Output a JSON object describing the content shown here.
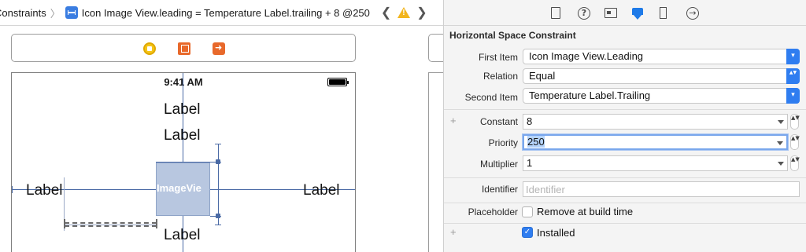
{
  "jumpbar": {
    "crumb_parent": "Constraints",
    "crumb_current": "Icon Image View.leading = Temperature Label.trailing + 8 @250",
    "prev_glyph": "❮",
    "next_glyph": "❯"
  },
  "canvas": {
    "status_time": "9:41 AM",
    "labels": {
      "top_1": "Label",
      "top_2": "Label",
      "left": "Label",
      "right": "Label",
      "bottom": "Label"
    },
    "image_view_text": "ImageVie",
    "dock_icons": [
      "view-controller-icon",
      "first-responder-icon",
      "exit-icon"
    ]
  },
  "inspector": {
    "tabs": [
      "file-icon",
      "help-icon",
      "identity-icon",
      "attributes-icon",
      "size-icon",
      "connections-icon"
    ],
    "active_tab": "attributes-icon",
    "section_title": "Horizontal Space Constraint",
    "first_item": {
      "label": "First Item",
      "value": "Icon Image View.Leading"
    },
    "relation": {
      "label": "Relation",
      "value": "Equal"
    },
    "second_item": {
      "label": "Second Item",
      "value": "Temperature Label.Trailing"
    },
    "constant": {
      "label": "Constant",
      "value": "8"
    },
    "priority": {
      "label": "Priority",
      "value": "250"
    },
    "multiplier": {
      "label": "Multiplier",
      "value": "1"
    },
    "identifier": {
      "label": "Identifier",
      "placeholder": "Identifier"
    },
    "placeholder": {
      "label": "Placeholder",
      "option": "Remove at build time",
      "checked": false
    },
    "installed": {
      "option": "Installed",
      "checked": true
    },
    "plus_glyph": "+",
    "stepper_up_down": "▲▼",
    "check_glyph": "✓"
  },
  "colors": {
    "accent": "#2f7df0",
    "guide": "#4a6aa5",
    "image_view_fill": "#b8c7e0",
    "warning": "#f2b51e",
    "dock_orange": "#e8692b"
  }
}
